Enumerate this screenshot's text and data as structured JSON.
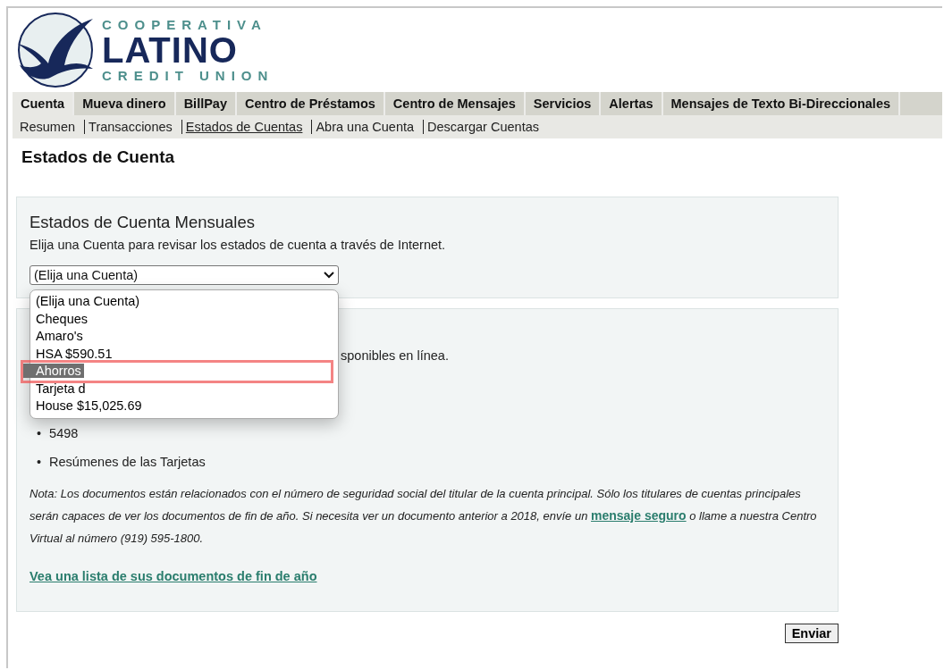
{
  "logo": {
    "top": "COOPERATIVA",
    "main": "LATINO",
    "bottom": "CREDIT UNION"
  },
  "tabs": [
    {
      "label": "Cuenta",
      "selected": true
    },
    {
      "label": "Mueva dinero",
      "selected": false
    },
    {
      "label": "BillPay",
      "selected": false
    },
    {
      "label": "Centro de Préstamos",
      "selected": false
    },
    {
      "label": "Centro de Mensajes",
      "selected": false
    },
    {
      "label": "Servicios",
      "selected": false
    },
    {
      "label": "Alertas",
      "selected": false
    },
    {
      "label": "Mensajes de Texto Bi-Direccionales",
      "selected": false
    }
  ],
  "subnav": [
    {
      "label": "Resumen",
      "selected": false
    },
    {
      "label": "Transacciones",
      "selected": false
    },
    {
      "label": "Estados de Cuentas",
      "selected": true
    },
    {
      "label": "Abra una Cuenta",
      "selected": false
    },
    {
      "label": "Descargar Cuentas",
      "selected": false
    }
  ],
  "title": "Estados de Cuenta",
  "monthly": {
    "heading": "Estados de Cuenta Mensuales",
    "description": "Elija una Cuenta para revisar los estados de cuenta a través de Internet.",
    "select": {
      "value": "(Elija una Cuenta)",
      "options": [
        {
          "label": "(Elija una Cuenta)",
          "highlighted": false
        },
        {
          "label": "Cheques",
          "highlighted": false
        },
        {
          "label": "Amaro's",
          "highlighted": false
        },
        {
          "label": "HSA $590.51",
          "highlighted": false
        },
        {
          "label": "Ahorros",
          "highlighted": true
        },
        {
          "label": "Tarjeta d",
          "highlighted": false
        },
        {
          "label": "House $15,025.69",
          "highlighted": false
        }
      ]
    }
  },
  "documents": {
    "partial_text": "sponibles en línea.",
    "bullet": "•",
    "items": [
      "5498",
      "Resúmenes de las Tarjetas"
    ],
    "note_before": "Nota: Los documentos están relacionados con el número de seguridad social del titular de la cuenta principal. Sólo los titulares de cuentas principales serán capaces de ver los documentos de fin de año. Si necesita ver un documento anterior a 2018, envíe un ",
    "note_link": "mensaje seguro",
    "note_after": " o llame a nuestra Centro Virtual al número (919) 595-1800.",
    "list_link": "Vea una lista de sus documentos de fin de año"
  },
  "submit": "Enviar"
}
